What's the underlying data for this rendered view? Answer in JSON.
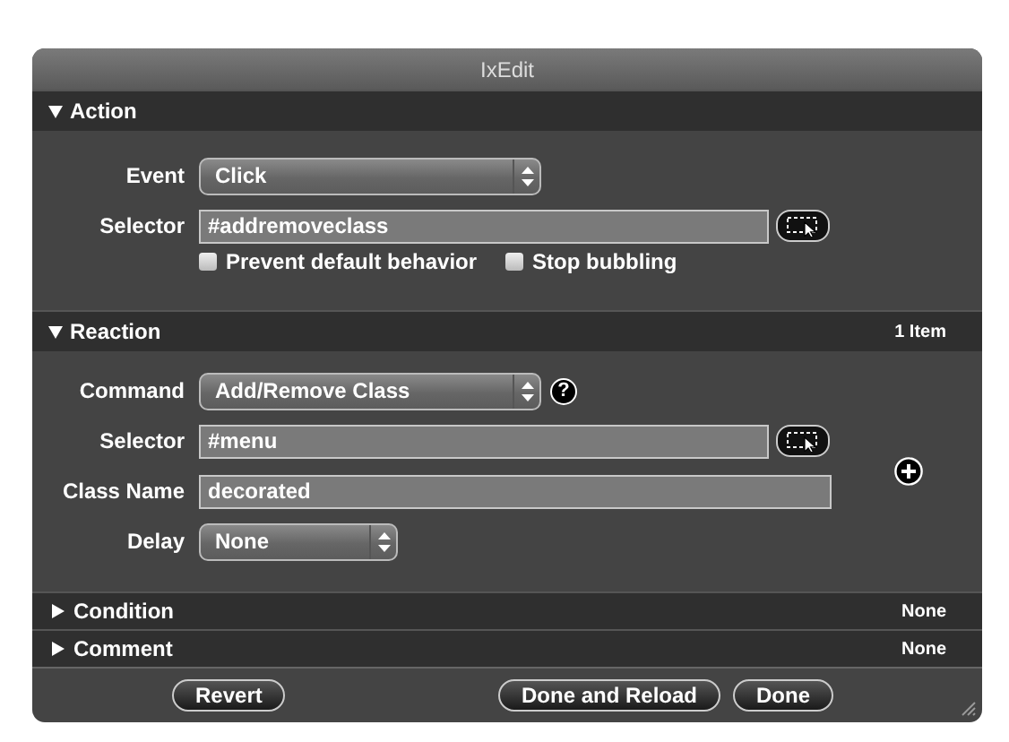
{
  "window": {
    "title": "IxEdit"
  },
  "action": {
    "title": "Action",
    "expanded": true,
    "fields": [
      {
        "kind": "select",
        "label": "Event",
        "value": "Click"
      },
      {
        "kind": "selector",
        "label": "Selector",
        "value": "#addremoveclass"
      }
    ],
    "checkboxes": [
      {
        "label": "Prevent default behavior",
        "checked": false
      },
      {
        "label": "Stop bubbling",
        "checked": false
      }
    ]
  },
  "reaction": {
    "title": "Reaction",
    "expanded": true,
    "summary": "1 Item",
    "fields": [
      {
        "kind": "select",
        "label": "Command",
        "value": "Add/Remove Class",
        "help": "?"
      },
      {
        "kind": "selector",
        "label": "Selector",
        "value": "#menu"
      },
      {
        "kind": "text",
        "label": "Class Name",
        "value": "decorated"
      },
      {
        "kind": "short-select",
        "label": "Delay",
        "value": "None"
      }
    ]
  },
  "collapsed": [
    {
      "title": "Condition",
      "expanded": false,
      "summary": "None"
    },
    {
      "title": "Comment",
      "expanded": false,
      "summary": "None"
    }
  ],
  "buttons": [
    {
      "label": "Revert",
      "kind": "left"
    },
    {
      "label": "Done and Reload",
      "kind": "right"
    },
    {
      "label": "Done",
      "kind": "right"
    }
  ]
}
